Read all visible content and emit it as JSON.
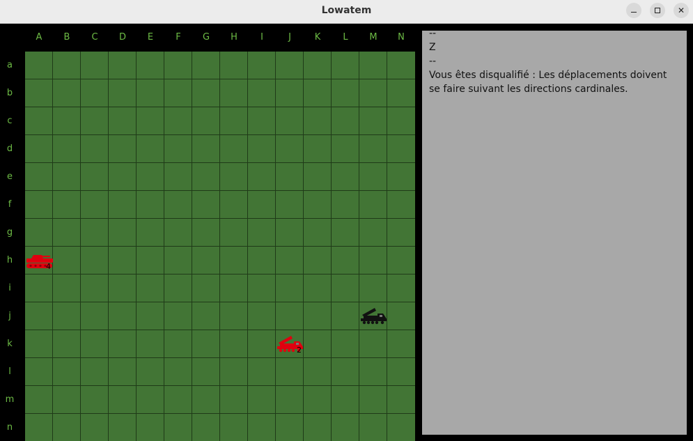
{
  "window": {
    "title": "Lowatem",
    "buttons": {
      "minimize": "minimize-icon",
      "maximize": "maximize-icon",
      "close": "✕"
    }
  },
  "board": {
    "columns": [
      "A",
      "B",
      "C",
      "D",
      "E",
      "F",
      "G",
      "H",
      "I",
      "J",
      "K",
      "L",
      "M",
      "N"
    ],
    "rows": [
      "a",
      "b",
      "c",
      "d",
      "e",
      "f",
      "g",
      "h",
      "i",
      "j",
      "k",
      "l",
      "m",
      "n"
    ],
    "colors": {
      "grass": "#427535",
      "grid": "#1f3a18",
      "labels": "#6dbb45",
      "background": "#000000"
    },
    "units": [
      {
        "id": "unit-h-a",
        "type": "tank",
        "color": "red",
        "row": "h",
        "col": "A",
        "hp": "4"
      },
      {
        "id": "unit-k-j",
        "type": "artillery",
        "color": "red",
        "row": "k",
        "col": "J",
        "hp": "2"
      },
      {
        "id": "unit-j-m",
        "type": "artillery",
        "color": "black",
        "row": "j",
        "col": "M",
        "hp": ""
      }
    ]
  },
  "panel": {
    "lines": [
      "--",
      "Z",
      "--",
      "Vous êtes disqualifié : Les déplacements doivent se faire suivant les directions cardinales."
    ]
  }
}
